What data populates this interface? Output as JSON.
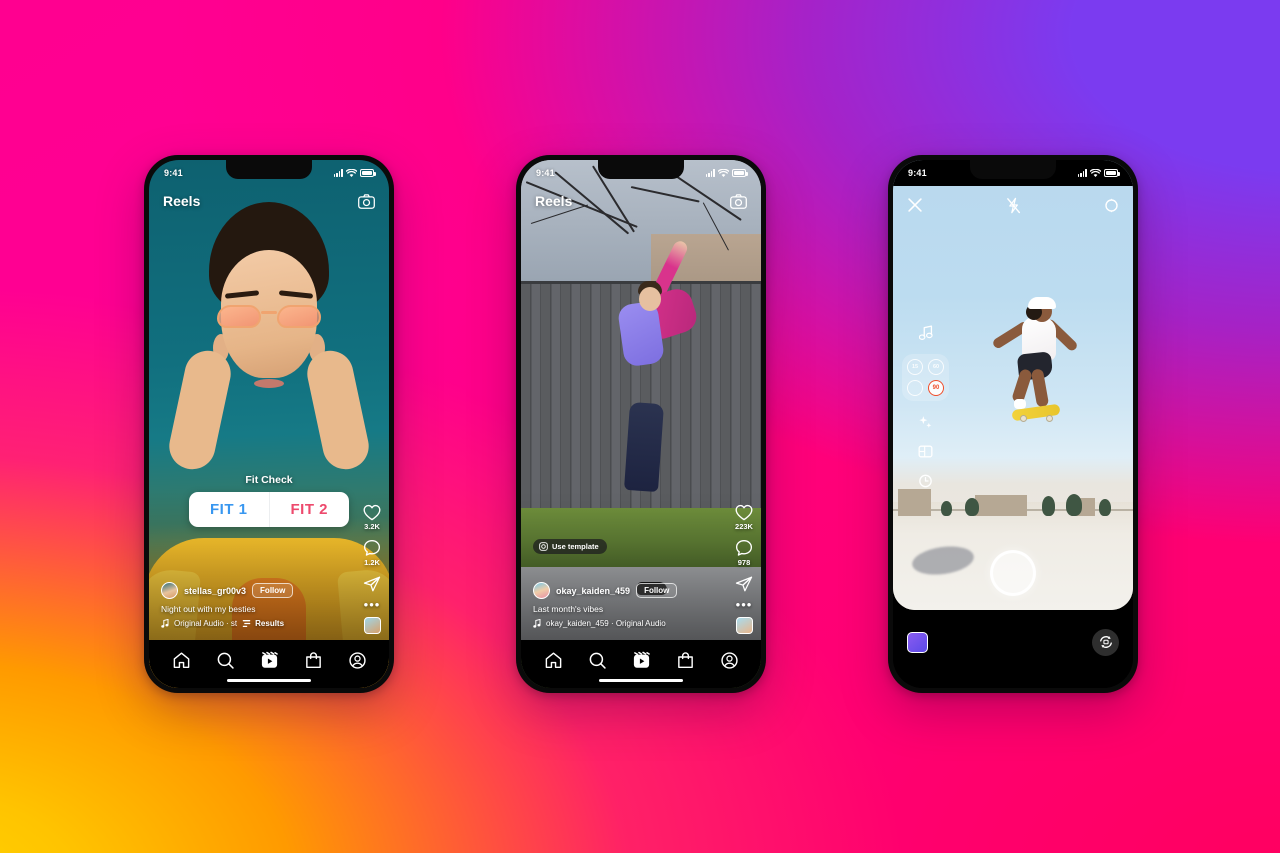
{
  "background": {
    "gradient_colors": [
      "#ff0090",
      "#7b3bf0",
      "#ffc800",
      "#ff0060"
    ],
    "description": "Instagram brand gradient backdrop"
  },
  "phones": [
    {
      "id": "phone-reels-poll",
      "status_bar": {
        "time": "9:41",
        "signal_icon": "cellular-bars-icon",
        "wifi_icon": "wifi-icon",
        "battery_icon": "battery-full-icon"
      },
      "header": {
        "title": "Reels",
        "camera_icon": "camera-icon"
      },
      "poll": {
        "question": "Fit Check",
        "option_a": "FIT 1",
        "option_b": "FIT 2",
        "color_a": "#3897f0",
        "color_b": "#ed4a6d"
      },
      "rail": {
        "like_icon": "heart-icon",
        "like_count": "3.2K",
        "comment_icon": "comment-icon",
        "comment_count": "1.2K",
        "share_icon": "paper-plane-icon",
        "more_icon": "more-dots-icon",
        "audio_thumb": "audio-thumbnail"
      },
      "caption": {
        "avatar": "user-avatar",
        "username": "stellas_gr00v3",
        "follow_label": "Follow",
        "text": "Night out with my besties",
        "audio_icon": "music-note-icon",
        "audio_label": "Original Audio · st",
        "results_icon": "poll-results-icon",
        "results_label": "Results"
      },
      "tabbar": {
        "items": [
          {
            "name": "home",
            "icon": "home-icon"
          },
          {
            "name": "search",
            "icon": "search-icon"
          },
          {
            "name": "reels",
            "icon": "reels-icon"
          },
          {
            "name": "shop",
            "icon": "shop-bag-icon"
          },
          {
            "name": "profile",
            "icon": "profile-circle-icon"
          }
        ]
      }
    },
    {
      "id": "phone-reels-template",
      "status_bar": {
        "time": "9:41",
        "signal_icon": "cellular-bars-icon",
        "wifi_icon": "wifi-icon",
        "battery_icon": "battery-full-icon"
      },
      "header": {
        "title": "Reels",
        "camera_icon": "camera-icon"
      },
      "template_pill": {
        "icon": "template-icon",
        "label": "Use template"
      },
      "rail": {
        "like_icon": "heart-icon",
        "like_count": "223K",
        "comment_icon": "comment-icon",
        "comment_count": "978",
        "share_icon": "paper-plane-icon",
        "more_icon": "more-dots-icon",
        "audio_thumb": "audio-thumbnail"
      },
      "caption": {
        "avatar": "user-avatar",
        "username": "okay_kaiden_459",
        "follow_label": "Follow",
        "text": "Last month's vibes",
        "audio_icon": "music-note-icon",
        "audio_label": "okay_kaiden_459 · Original Audio"
      },
      "tabbar": {
        "items": [
          {
            "name": "home",
            "icon": "home-icon"
          },
          {
            "name": "search",
            "icon": "search-icon"
          },
          {
            "name": "reels",
            "icon": "reels-icon"
          },
          {
            "name": "shop",
            "icon": "shop-bag-icon"
          },
          {
            "name": "profile",
            "icon": "profile-circle-icon"
          }
        ]
      }
    },
    {
      "id": "phone-camera",
      "status_bar": {
        "time": "9:41",
        "signal_icon": "cellular-bars-icon",
        "wifi_icon": "wifi-icon",
        "battery_icon": "battery-full-icon"
      },
      "top_bar": {
        "close_icon": "close-x-icon",
        "flash_icon": "flash-off-icon",
        "settings_icon": "sparkle-settings-icon"
      },
      "left_tools": [
        {
          "name": "audio",
          "icon": "music-note-icon",
          "label": ""
        },
        {
          "name": "effects",
          "icon": "sparkles-icon",
          "label": ""
        },
        {
          "name": "layout",
          "icon": "layout-grid-icon",
          "label": ""
        },
        {
          "name": "timer",
          "icon": "timer-icon",
          "label": ""
        }
      ],
      "duration_panel": {
        "options": [
          {
            "label": "15",
            "active": false
          },
          {
            "label": "60",
            "active": false
          },
          {
            "label": "",
            "active": false
          },
          {
            "label": "90",
            "active": true
          }
        ],
        "active_color": "#f04e2b"
      },
      "shutter": {
        "name": "record-button"
      },
      "bottom_bar": {
        "gallery_icon": "gallery-thumbnail",
        "flip_icon": "flip-camera-icon"
      }
    }
  ]
}
